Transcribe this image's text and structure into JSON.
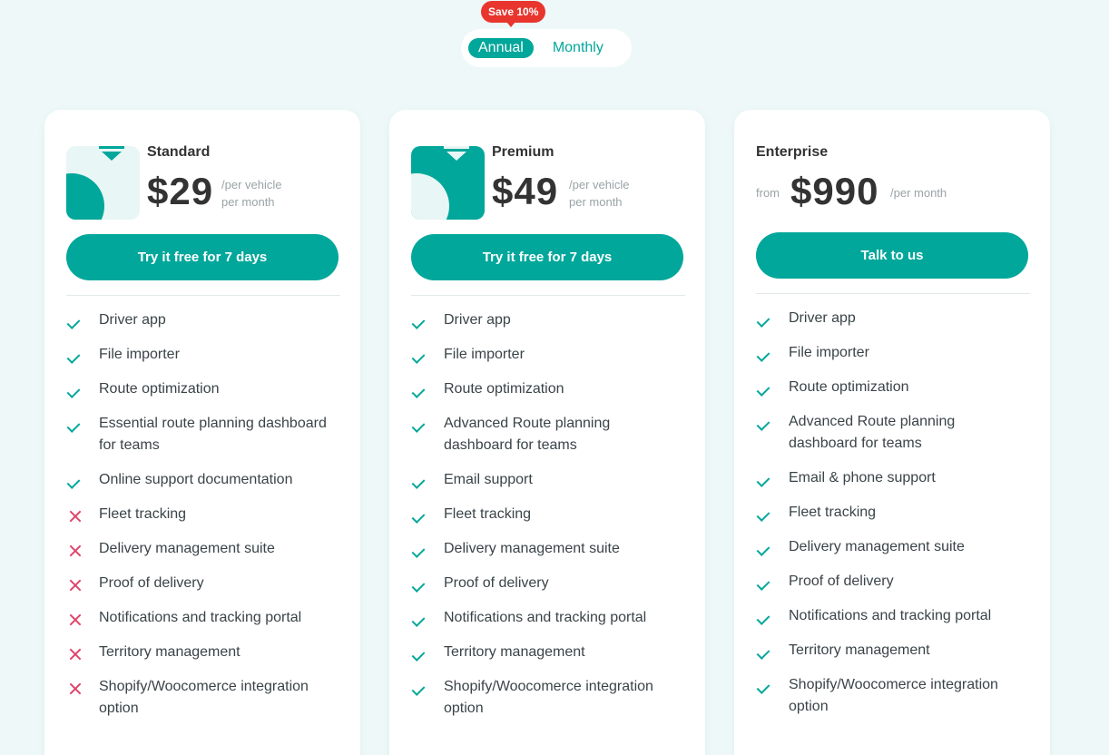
{
  "billing_toggle": {
    "save_badge": "Save 10%",
    "annual_label": "Annual",
    "monthly_label": "Monthly",
    "selected": "Annual"
  },
  "colors": {
    "accent": "#00a79a",
    "badge": "#e8362e",
    "cross": "#e0446b",
    "background": "#eef8f8"
  },
  "plans": [
    {
      "name": "Standard",
      "price": "$29",
      "per_line1": "/per vehicle",
      "per_line2": "per month",
      "cta": "Try it free for 7 days",
      "features": [
        {
          "text": "Driver app",
          "included": true
        },
        {
          "text": "File importer",
          "included": true
        },
        {
          "text": "Route optimization",
          "included": true
        },
        {
          "text": "Essential route planning dashboard for teams",
          "included": true
        },
        {
          "text": "Online support documentation",
          "included": true
        },
        {
          "text": "Fleet tracking",
          "included": false
        },
        {
          "text": "Delivery management suite",
          "included": false
        },
        {
          "text": "Proof of delivery",
          "included": false
        },
        {
          "text": "Notifications and tracking portal",
          "included": false
        },
        {
          "text": "Territory management",
          "included": false
        },
        {
          "text": "Shopify/Woocomerce integration option",
          "included": false
        }
      ]
    },
    {
      "name": "Premium",
      "price": "$49",
      "per_line1": "/per vehicle",
      "per_line2": "per month",
      "cta": "Try it free for 7 days",
      "features": [
        {
          "text": "Driver app",
          "included": true
        },
        {
          "text": "File importer",
          "included": true
        },
        {
          "text": "Route optimization",
          "included": true
        },
        {
          "text": "Advanced Route planning dashboard for teams",
          "included": true
        },
        {
          "text": "Email support",
          "included": true
        },
        {
          "text": "Fleet tracking",
          "included": true
        },
        {
          "text": "Delivery management suite",
          "included": true
        },
        {
          "text": "Proof of delivery",
          "included": true
        },
        {
          "text": "Notifications and tracking portal",
          "included": true
        },
        {
          "text": "Territory management",
          "included": true
        },
        {
          "text": "Shopify/Woocomerce integration option",
          "included": true
        }
      ]
    },
    {
      "name": "Enterprise",
      "from": "from",
      "price": "$990",
      "per_line1": "/per month",
      "cta": "Talk to us",
      "features": [
        {
          "text": "Driver app",
          "included": true
        },
        {
          "text": "File importer",
          "included": true
        },
        {
          "text": "Route optimization",
          "included": true
        },
        {
          "text": "Advanced Route planning dashboard for teams",
          "included": true
        },
        {
          "text": "Email & phone support",
          "included": true
        },
        {
          "text": "Fleet tracking",
          "included": true
        },
        {
          "text": "Delivery management suite",
          "included": true
        },
        {
          "text": "Proof of delivery",
          "included": true
        },
        {
          "text": "Notifications and tracking portal",
          "included": true
        },
        {
          "text": "Territory management",
          "included": true
        },
        {
          "text": "Shopify/Woocomerce integration option",
          "included": true
        }
      ]
    }
  ]
}
